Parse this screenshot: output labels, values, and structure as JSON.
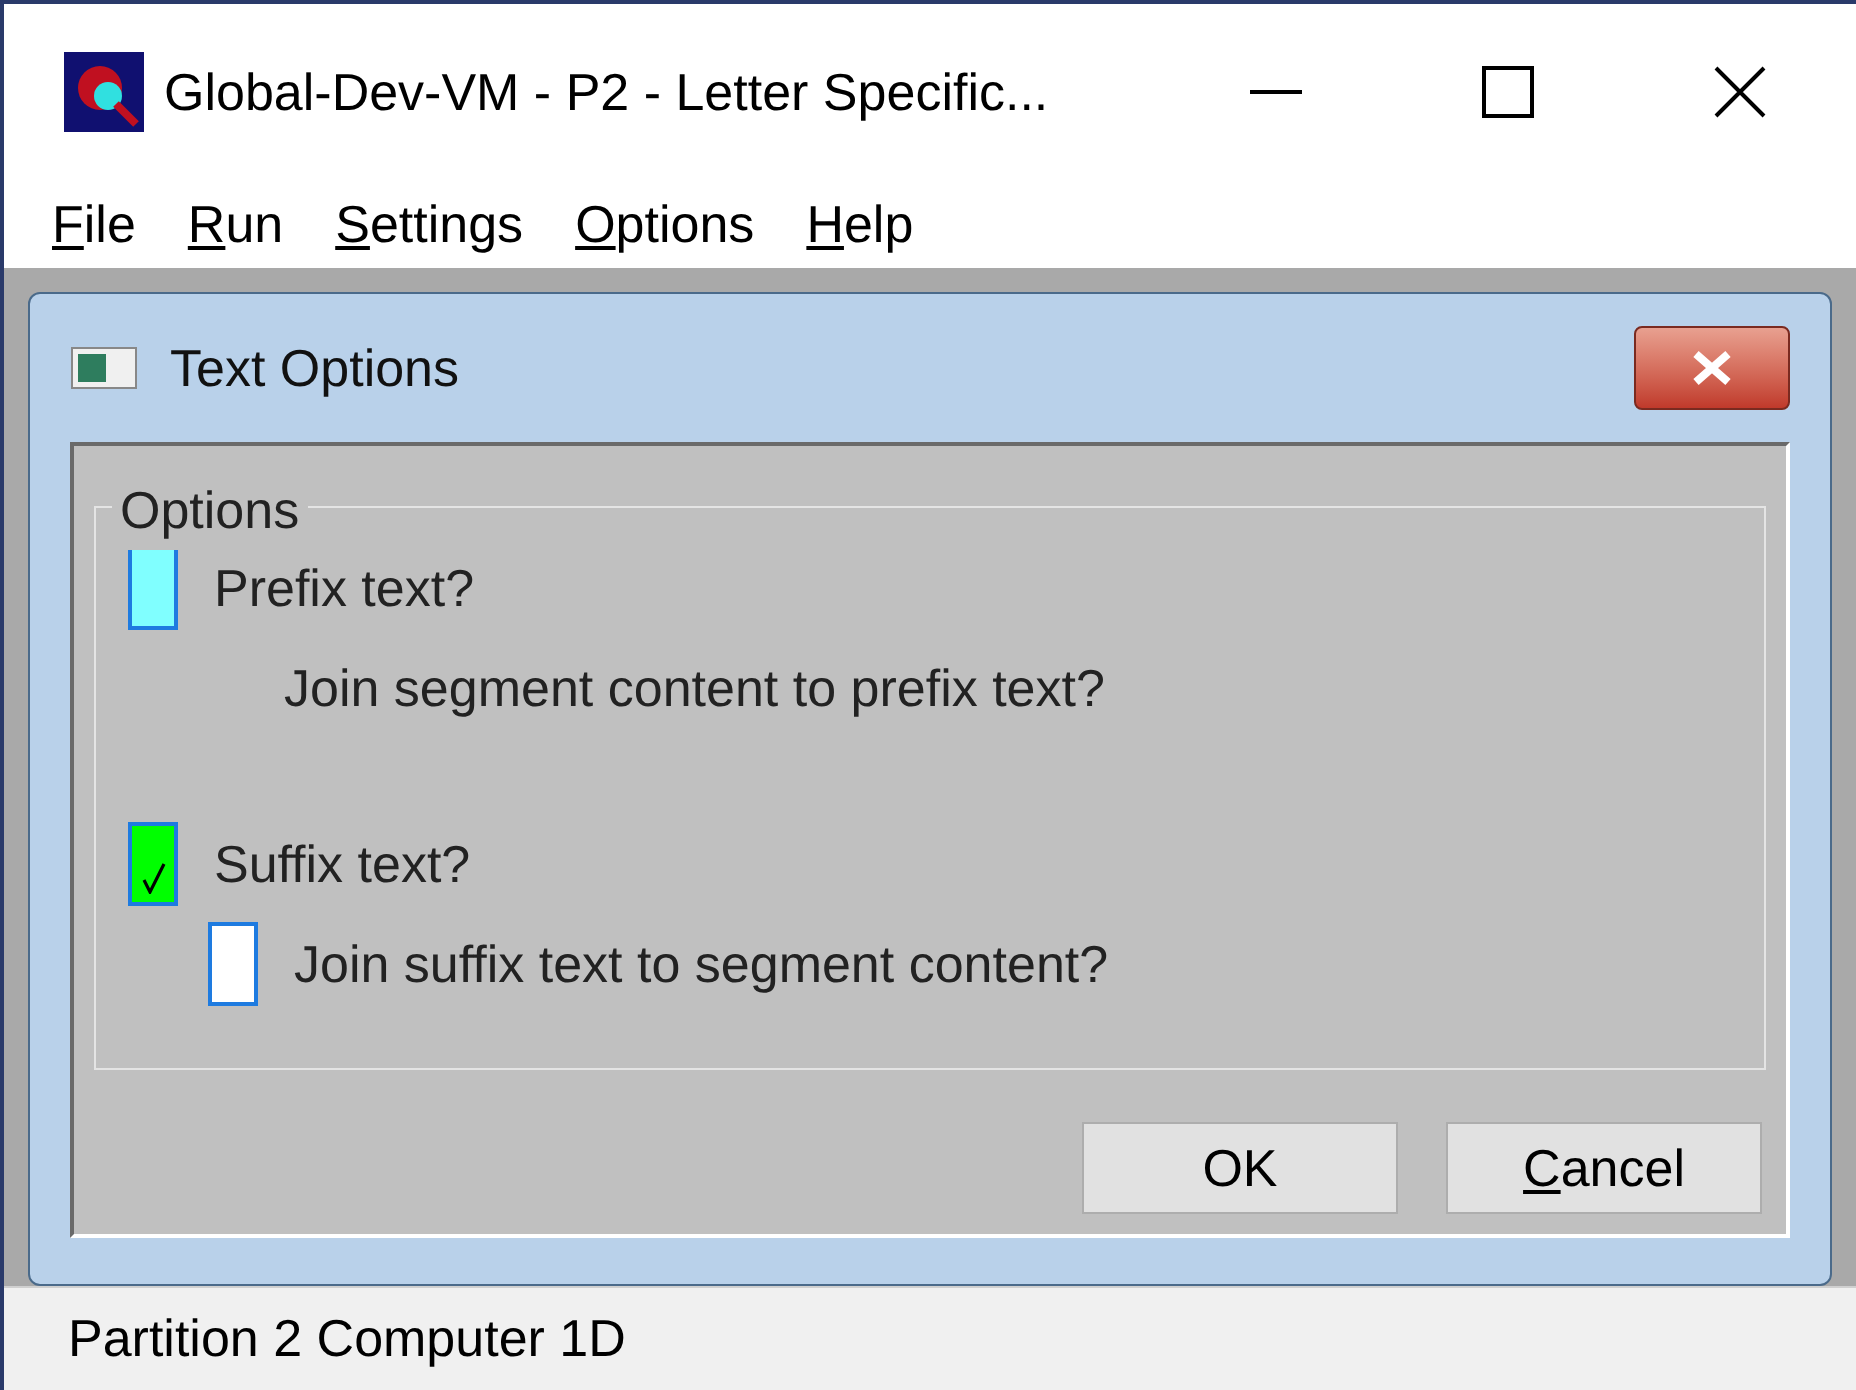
{
  "window": {
    "title": "Global-Dev-VM - P2 - Letter Specific..."
  },
  "menu": [
    {
      "label": "File",
      "mnemonic": true
    },
    {
      "label": "Run",
      "mnemonic": true
    },
    {
      "label": "Settings",
      "mnemonic": true
    },
    {
      "label": "Options",
      "mnemonic": true
    },
    {
      "label": "Help",
      "mnemonic": true
    }
  ],
  "dialog": {
    "title": "Text Options",
    "group": {
      "title": "Options",
      "items": [
        {
          "kind": "checkbox",
          "label": "Prefix text?",
          "checked": false,
          "color": "#80ffff",
          "children": [
            {
              "kind": "label",
              "label": "Join segment content to prefix text?"
            }
          ]
        },
        {
          "kind": "checkbox",
          "label": "Suffix text?",
          "checked": true,
          "color": "#00ff00",
          "children": [
            {
              "kind": "checkbox",
              "label": "Join suffix text to segment content?",
              "checked": false,
              "color": "#ffffff"
            }
          ]
        }
      ]
    },
    "buttons": [
      {
        "label": "OK",
        "mnemonic": false
      },
      {
        "label": "Cancel",
        "mnemonic": true
      }
    ]
  },
  "status_bar": {
    "text": "Partition 2 Computer 1D"
  }
}
